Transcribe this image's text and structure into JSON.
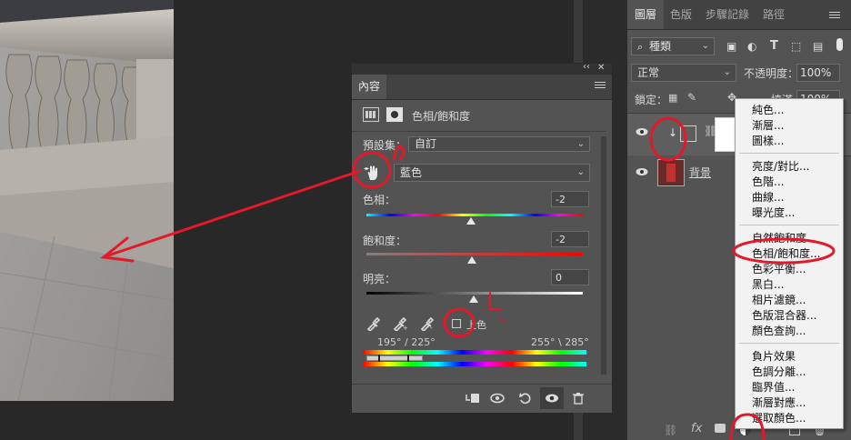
{
  "properties_panel": {
    "collapse_glyph": "‹‹",
    "close_glyph": "✕",
    "tab_label": "內容",
    "adjustment_title": "色相/飽和度",
    "preset_label": "預設集：",
    "preset_value": "自訂",
    "channel_value": "藍色",
    "hue_label": "色相：",
    "hue_value": "-2",
    "saturation_label": "飽和度：",
    "saturation_value": "-2",
    "lightness_label": "明亮：",
    "lightness_value": "0",
    "colorize_label": "上色",
    "range_left": "195° / 225°",
    "range_right": "255° \\ 285°",
    "hue_pos": 0.5,
    "sat_pos": 0.5,
    "light_pos": 0.5
  },
  "layers_panel": {
    "tabs": [
      "圖層",
      "色版",
      "步驟記錄",
      "路徑"
    ],
    "filter_kind": "種類",
    "blend_mode": "正常",
    "opacity_label": "不透明度：",
    "opacity_value": "100%",
    "lock_label": "鎖定：",
    "fill_label": "填滿",
    "fill_value": "100%",
    "background_layer_name": "背景",
    "fx_label": "fx"
  },
  "adjustment_menu": {
    "group1": [
      "純色...",
      "漸層...",
      "圖樣..."
    ],
    "group2": [
      "亮度/對比...",
      "色階...",
      "曲線...",
      "曝光度..."
    ],
    "group3": [
      "自然飽和度...",
      "色相/飽和度...",
      "色彩平衡...",
      "黑白...",
      "相片濾鏡...",
      "色版混合器...",
      "顏色查詢..."
    ],
    "group4": [
      "負片效果",
      "色調分離...",
      "臨界值...",
      "漸層對應...",
      "選取顏色..."
    ]
  },
  "annotation": {
    "mark": "c"
  },
  "colors": {
    "annotation_red": "#e3192a",
    "panel_bg": "#535353",
    "panel_dark": "#424242",
    "menu_bg": "#f2f2f2"
  }
}
